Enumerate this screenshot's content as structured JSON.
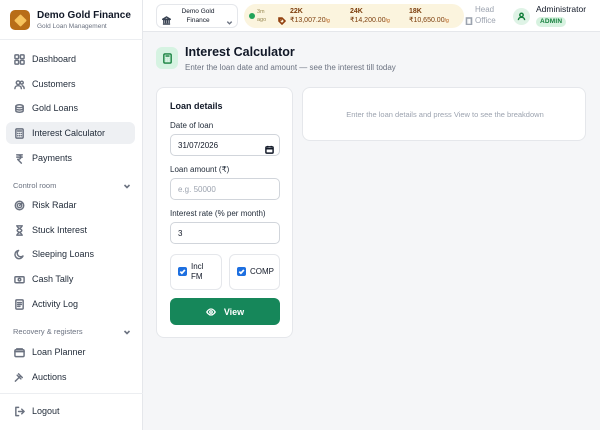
{
  "brand": {
    "name": "Demo Gold Finance",
    "subtitle": "Gold Loan Management"
  },
  "sidebar": {
    "items": [
      {
        "label": "Dashboard",
        "icon": "grid-icon"
      },
      {
        "label": "Customers",
        "icon": "users-icon"
      },
      {
        "label": "Gold Loans",
        "icon": "coins-icon"
      },
      {
        "label": "Interest Calculator",
        "icon": "calculator-icon",
        "active": true
      },
      {
        "label": "Payments",
        "icon": "rupee-icon"
      }
    ],
    "control_room": {
      "label": "Control room",
      "items": [
        {
          "label": "Risk Radar",
          "icon": "radar-icon"
        },
        {
          "label": "Stuck Interest",
          "icon": "hourglass-icon"
        },
        {
          "label": "Sleeping Loans",
          "icon": "moon-icon"
        },
        {
          "label": "Cash Tally",
          "icon": "cash-icon"
        },
        {
          "label": "Activity Log",
          "icon": "log-icon"
        }
      ]
    },
    "recovery": {
      "label": "Recovery & registers",
      "items": [
        {
          "label": "Loan Planner",
          "icon": "wallet-icon"
        },
        {
          "label": "Auctions",
          "icon": "gavel-icon"
        }
      ]
    },
    "logout": "Logout"
  },
  "topbar": {
    "branch_line1": "Demo Gold",
    "branch_line2": "Finance",
    "rates": {
      "ago_line1": "3m",
      "ago_line2": "ago",
      "items": [
        {
          "karat": "22K",
          "price": "₹13,007.20",
          "unit": "/g"
        },
        {
          "karat": "24K",
          "price": "₹14,200.00",
          "unit": "/g"
        },
        {
          "karat": "18K",
          "price": "₹10,650.00",
          "unit": "/g"
        }
      ]
    },
    "office_line1": "Head",
    "office_line2": "Office",
    "user_name": "Administrator",
    "user_role": "ADMIN"
  },
  "page": {
    "title": "Interest Calculator",
    "subtitle": "Enter the loan date and amount — see the interest till today"
  },
  "form": {
    "title": "Loan details",
    "date_label": "Date of loan",
    "date_value": "31/07/2026",
    "amount_label": "Loan amount (₹)",
    "amount_placeholder": "e.g. 50000",
    "rate_label": "Interest rate (% per month)",
    "rate_value": "3",
    "incl_fm_line1": "Incl",
    "incl_fm_line2": "FM",
    "comp_label": "COMP",
    "view_label": "View"
  },
  "result": {
    "empty_message": "Enter the loan details and press View to see the breakdown"
  },
  "colors": {
    "accent": "#16875a",
    "brand": "#b86d17",
    "checkbox": "#1d6fe0"
  }
}
